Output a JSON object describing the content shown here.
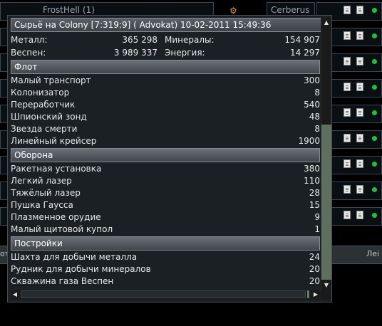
{
  "background": {
    "row_names": [
      "FrostHell (1)"
    ],
    "player_name": "Cerberus",
    "bottom_left_text": "от",
    "bottom_right_text": "Леі"
  },
  "popup": {
    "title": "Сырьё на Colony [7:319:9] ( Advokat) 10-02-2011 15:49:36",
    "resources": {
      "metal_label": "Металл:",
      "metal_value": "365 298",
      "minerals_label": "Минералы:",
      "minerals_value": "154 907",
      "gas_label": "Веспен:",
      "gas_value": "3 989 337",
      "energy_label": "Энергия:",
      "energy_value": "14 297"
    },
    "sections": [
      {
        "title": "Флот",
        "items": [
          {
            "label": "Малый транспорт",
            "value": "300"
          },
          {
            "label": "Колонизатор",
            "value": "8"
          },
          {
            "label": "Переработчик",
            "value": "540"
          },
          {
            "label": "Шпионский зонд",
            "value": "48"
          },
          {
            "label": "Звезда смерти",
            "value": "8"
          },
          {
            "label": "Линейный крейсер",
            "value": "1900"
          }
        ]
      },
      {
        "title": "Оборона",
        "items": [
          {
            "label": "Ракетная установка",
            "value": "380"
          },
          {
            "label": "Легкий лазер",
            "value": "110"
          },
          {
            "label": "Тяжёлый лазер",
            "value": "28"
          },
          {
            "label": "Пушка Гаусса",
            "value": "15"
          },
          {
            "label": "Плазменное орудие",
            "value": "9"
          },
          {
            "label": "Малый щитовой купол",
            "value": "1"
          }
        ]
      },
      {
        "title": "Постройки",
        "items": [
          {
            "label": "Шахта для добычи металла",
            "value": "24"
          },
          {
            "label": "Рудник для добычи минералов",
            "value": "20"
          },
          {
            "label": "Скважина газа Веспен",
            "value": "20"
          }
        ]
      }
    ]
  },
  "icons": {
    "scroll_up": "▲",
    "scroll_down": "▼",
    "scroll_left": "◀",
    "scroll_right": "▶"
  }
}
